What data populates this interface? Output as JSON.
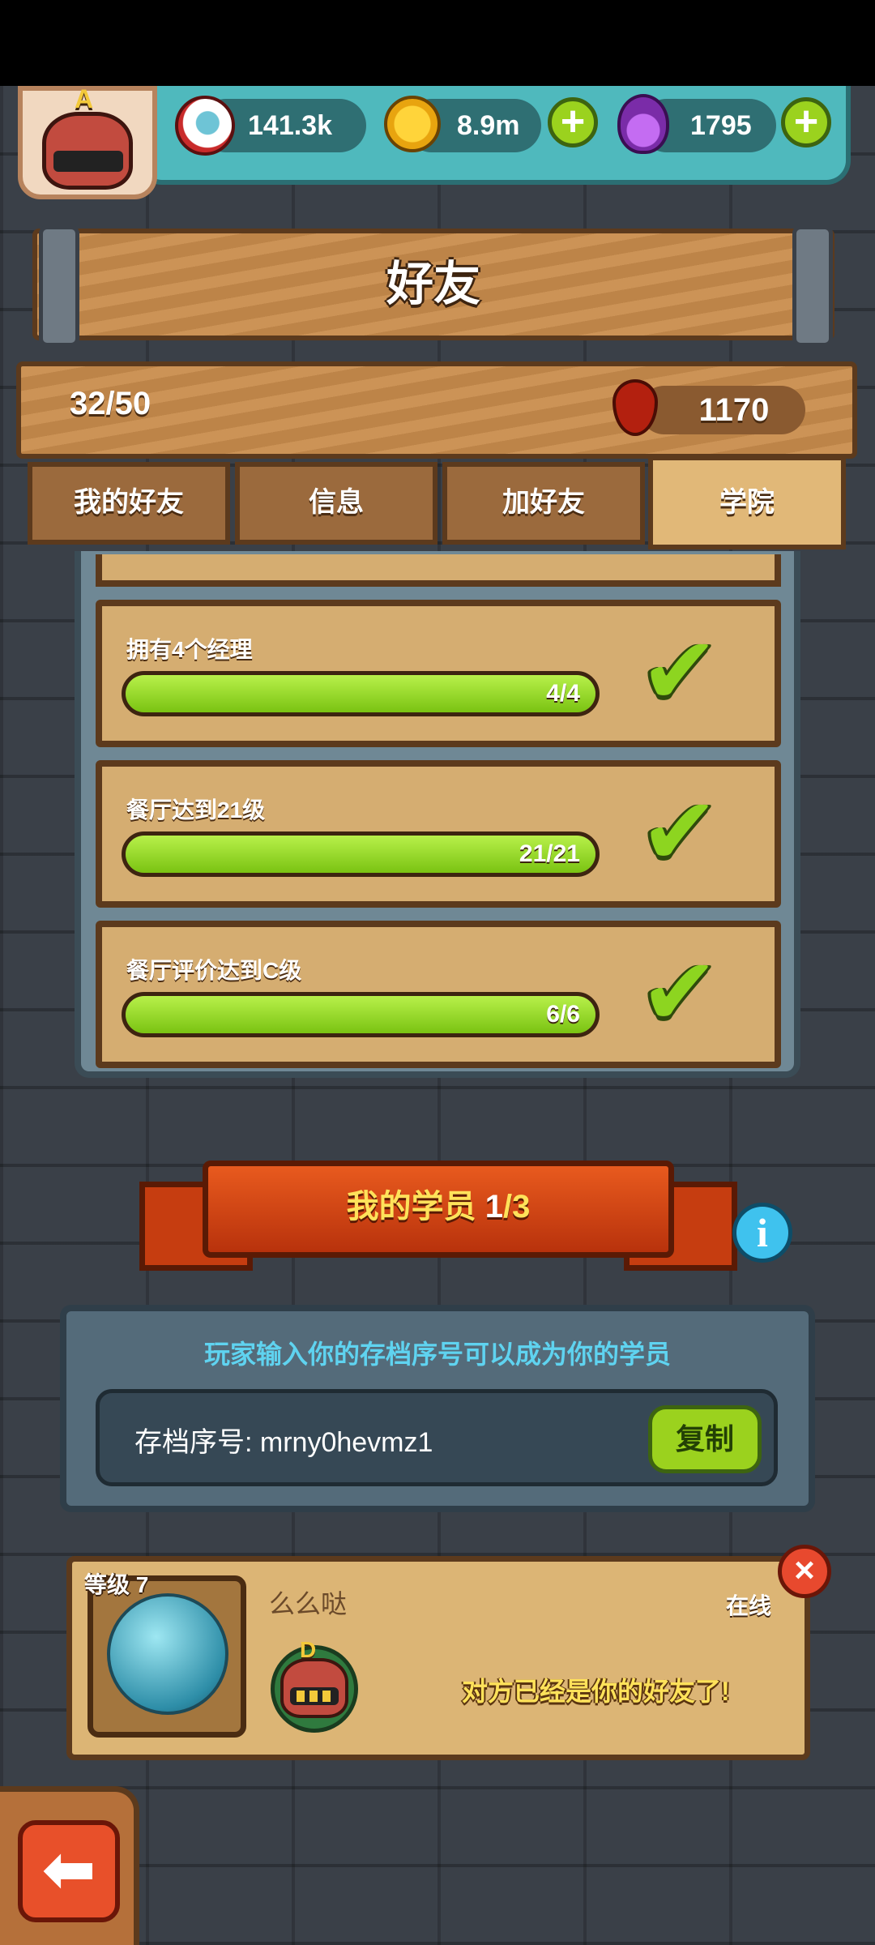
{
  "resources": {
    "eyeball": {
      "value": "141.3k",
      "icon": "eyeball-icon"
    },
    "coins": {
      "value": "8.9m",
      "icon": "coin-icon"
    },
    "potion": {
      "value": "1795",
      "icon": "potion-icon"
    },
    "player_grade": "A"
  },
  "header": {
    "title": "好友"
  },
  "info": {
    "friend_count": "32/50",
    "blood_points": "1170"
  },
  "tabs": [
    {
      "label": "我的好友",
      "active": false
    },
    {
      "label": "信息",
      "active": false
    },
    {
      "label": "加好友",
      "active": false
    },
    {
      "label": "学院",
      "active": true
    }
  ],
  "tasks": [
    {
      "label": "拥有4个经理",
      "progress": "4/4",
      "fraction": 1.0,
      "done": true
    },
    {
      "label": "餐厅达到21级",
      "progress": "21/21",
      "fraction": 1.0,
      "done": true
    },
    {
      "label": "餐厅评价达到C级",
      "progress": "6/6",
      "fraction": 1.0,
      "done": true
    }
  ],
  "students": {
    "title_prefix": "我的学员 ",
    "count_current": "1",
    "count_sep": "/3",
    "hint": "玩家输入你的存档序号可以成为你的学员",
    "code_label": "存档序号: mrny0hevmz1",
    "copy_label": "复制",
    "list": [
      {
        "level": "等级 7",
        "name": "么么哒",
        "status": "在线",
        "grade": "D",
        "message": "对方已经是你的好友了!"
      }
    ]
  },
  "colors": {
    "accent_green": "#9bd21e",
    "wood": "#c98c4c",
    "ribbon": "#e85a1e",
    "highlight_text": "#ffe25a"
  }
}
